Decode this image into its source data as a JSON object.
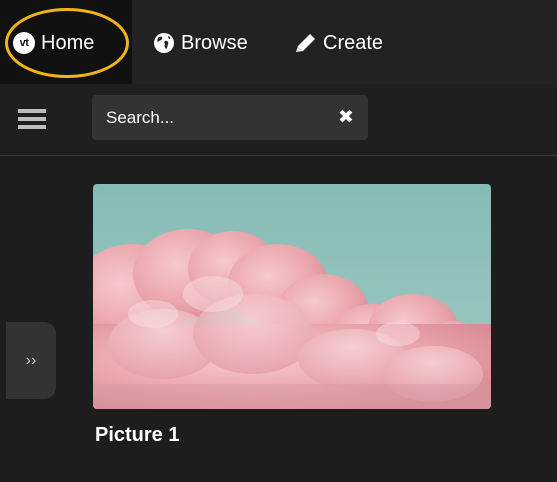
{
  "nav": {
    "home": {
      "label": "Home",
      "icon": "vt-logo-icon",
      "logo_text": "vt",
      "highlight_color": "#f0b419"
    },
    "browse": {
      "label": "Browse",
      "icon": "globe-icon"
    },
    "create": {
      "label": "Create",
      "icon": "pencil-icon"
    }
  },
  "toolbar": {
    "menu_icon": "hamburger-icon",
    "search": {
      "placeholder": "Search...",
      "value": "",
      "clear_icon": "close-icon"
    },
    "clear_glyph": "✖"
  },
  "sidebar": {
    "toggle_icon": "double-chevron-right-icon",
    "toggle_glyph": "››"
  },
  "gallery": {
    "items": [
      {
        "title": "Picture 1",
        "image": "pink clouds on teal sky"
      }
    ]
  },
  "colors": {
    "background": "#1d1d1d",
    "topbar": "#222222",
    "home_tab": "#111111",
    "search_bg": "#333333",
    "highlight": "#f0b419"
  }
}
